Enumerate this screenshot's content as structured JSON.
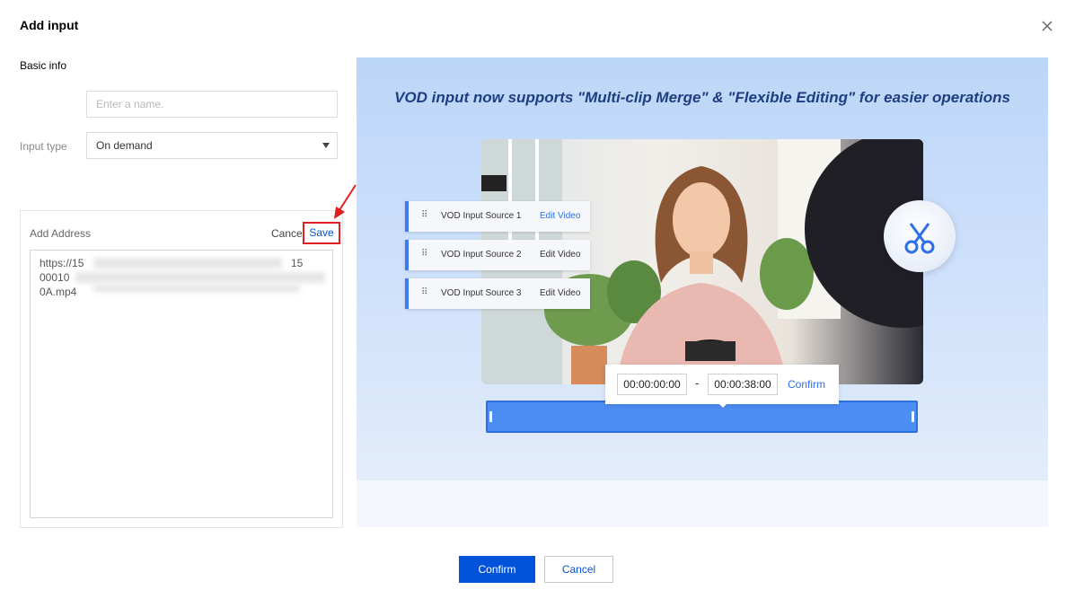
{
  "dialog": {
    "title": "Add input"
  },
  "basic_info": {
    "section_label": "Basic info",
    "name_placeholder": "Enter a name.",
    "name_value": "",
    "input_type_label": "Input type",
    "input_type_value": "On demand"
  },
  "address": {
    "label": "Add Address",
    "cancel_label": "Cancel",
    "save_label": "Save",
    "lines": [
      "https://15",
      "00010",
      "0A.mp4"
    ],
    "line1_tail": "15"
  },
  "banner": {
    "headline": "VOD input now supports \"Multi-clip Merge\" & \"Flexible Editing\" for easier operations",
    "sources": [
      {
        "label": "VOD Input Source 1",
        "action": "Edit Video",
        "active": true
      },
      {
        "label": "VOD Input Source 2",
        "action": "Edit Video",
        "active": false
      },
      {
        "label": "VOD Input Source 3",
        "action": "Edit Video",
        "active": false
      }
    ],
    "start_time": "00:00:00:00",
    "time_separator": "-",
    "end_time": "00:00:38:00",
    "time_confirm": "Confirm"
  },
  "footer": {
    "confirm_label": "Confirm",
    "cancel_label": "Cancel"
  },
  "colors": {
    "primary": "#0052d9",
    "highlight_border": "#e02020",
    "accent_blue": "#3d7cf0"
  }
}
